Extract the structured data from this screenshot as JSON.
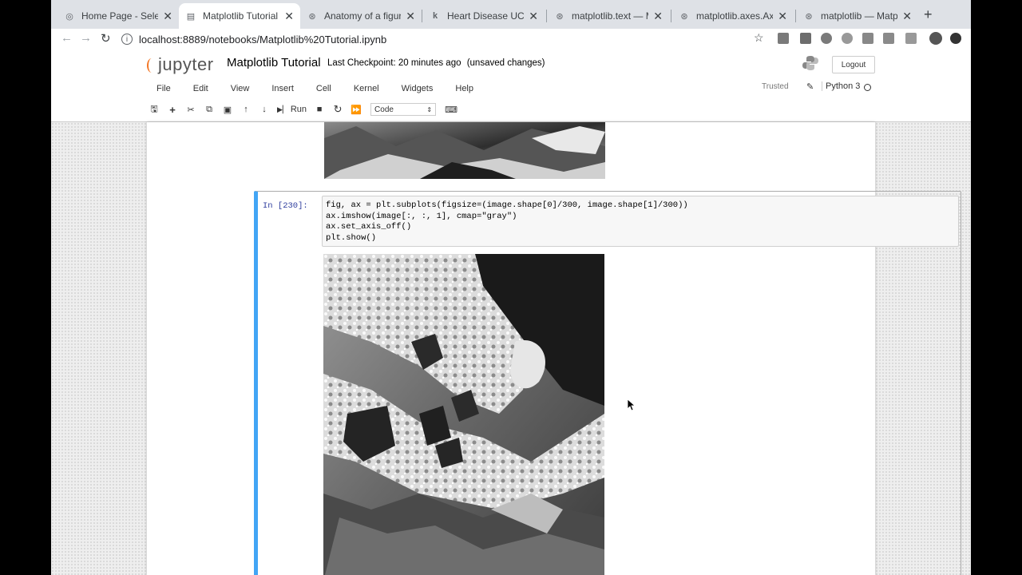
{
  "browser": {
    "tabs": [
      {
        "title": "Home Page - Select o",
        "icon": "jupyter-favicon",
        "active": false
      },
      {
        "title": "Matplotlib Tutorial - J",
        "icon": "notebook-favicon",
        "active": true
      },
      {
        "title": "Anatomy of a figure —",
        "icon": "matplotlib-favicon",
        "active": false
      },
      {
        "title": "Heart Disease UCI | K",
        "icon": "kaggle-favicon",
        "active": false
      },
      {
        "title": "matplotlib.text — Ma",
        "icon": "matplotlib-favicon",
        "active": false
      },
      {
        "title": "matplotlib.axes.Axes.",
        "icon": "matplotlib-favicon",
        "active": false
      },
      {
        "title": "matplotlib — Matplotl",
        "icon": "matplotlib-favicon",
        "active": false
      }
    ],
    "url": "localhost:8889/notebooks/Matplotlib%20Tutorial.ipynb"
  },
  "jupyter": {
    "logo_text": "jupyter",
    "notebook_name": "Matplotlib Tutorial",
    "checkpoint": "Last Checkpoint: 20 minutes ago",
    "unsaved": "(unsaved changes)",
    "logout_label": "Logout",
    "menu": [
      "File",
      "Edit",
      "View",
      "Insert",
      "Cell",
      "Kernel",
      "Widgets",
      "Help"
    ],
    "trusted": "Trusted",
    "kernel": "Python 3",
    "run_label": "Run",
    "cell_type": "Code"
  },
  "cell": {
    "prompt": "In [230]:",
    "code": [
      "fig, ax = plt.subplots(figsize=(image.shape[0]/300, image.shape[1]/300))",
      "ax.imshow(image[:, :, 1], cmap=\"gray\")",
      "ax.set_axis_off()",
      "plt.show()"
    ]
  }
}
